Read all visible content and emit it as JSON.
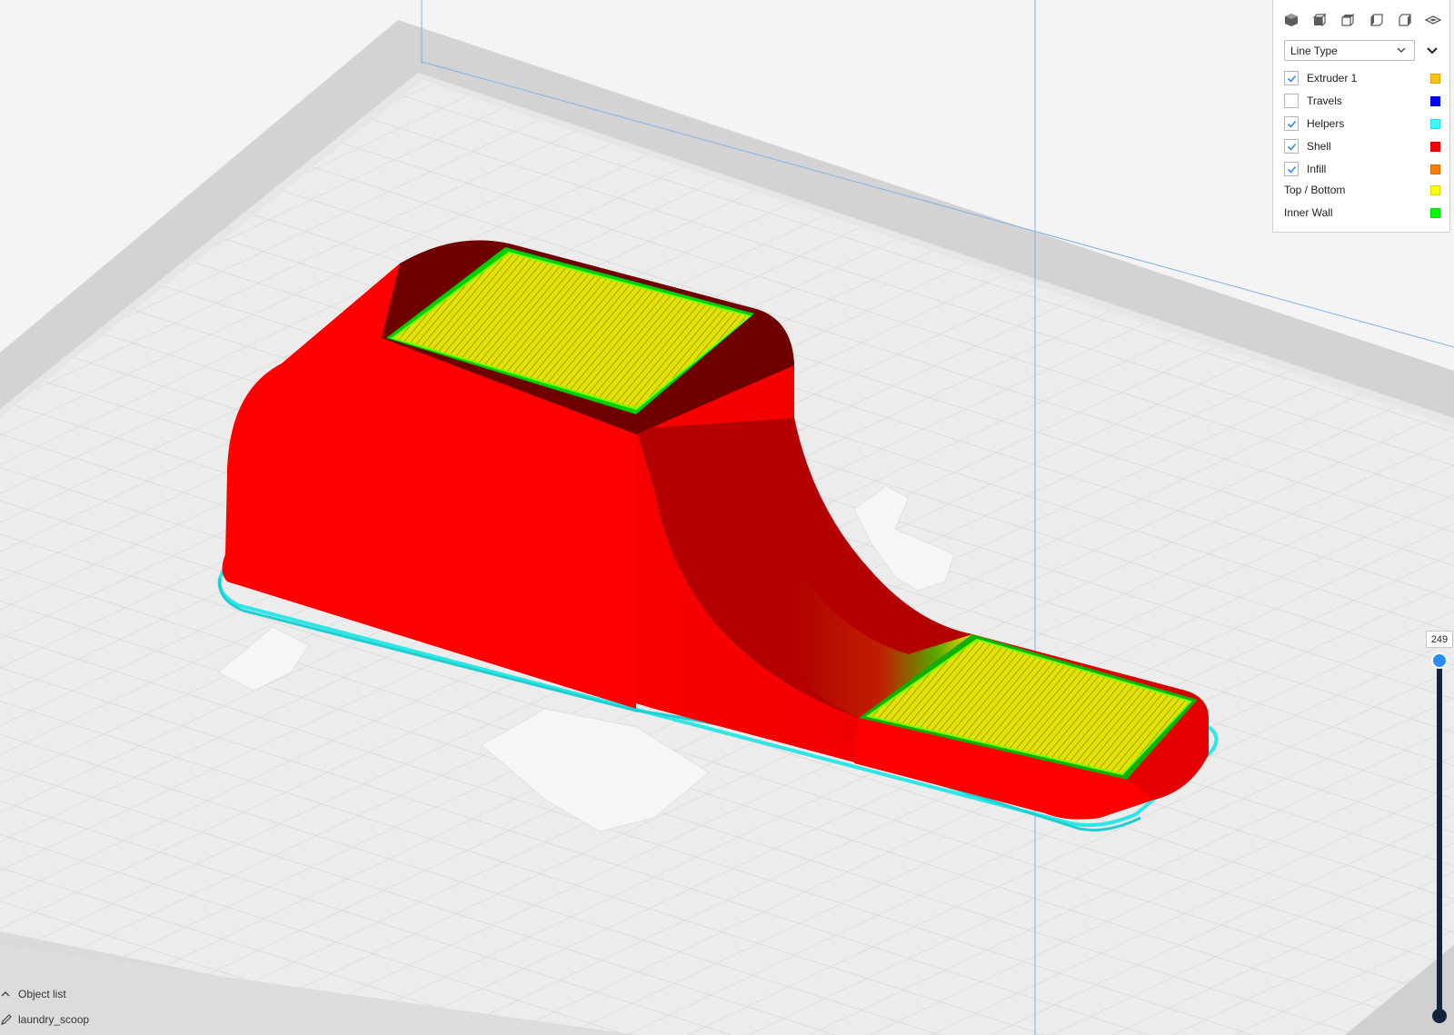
{
  "view_panel": {
    "camera_buttons": [
      {
        "name": "3d-view-icon"
      },
      {
        "name": "front-view-icon"
      },
      {
        "name": "top-view-icon"
      },
      {
        "name": "left-view-icon"
      },
      {
        "name": "right-view-icon"
      },
      {
        "name": "xray-view-icon"
      }
    ],
    "color_scheme": "Line Type",
    "legend": [
      {
        "label": "Extruder 1",
        "has_checkbox": true,
        "checked": true,
        "color": "#ffc20e"
      },
      {
        "label": "Travels",
        "has_checkbox": true,
        "checked": false,
        "color": "#0000ff"
      },
      {
        "label": "Helpers",
        "has_checkbox": true,
        "checked": true,
        "color": "#33ffff"
      },
      {
        "label": "Shell",
        "has_checkbox": true,
        "checked": true,
        "color": "#ff0000"
      },
      {
        "label": "Infill",
        "has_checkbox": true,
        "checked": true,
        "color": "#ff7f00"
      },
      {
        "label": "Top / Bottom",
        "has_checkbox": false,
        "color": "#ffff00"
      },
      {
        "label": "Inner Wall",
        "has_checkbox": false,
        "color": "#00ff00"
      }
    ]
  },
  "layer_slider": {
    "current_layer": "249"
  },
  "object_list": {
    "header": "Object list",
    "items": [
      "laundry_scoop"
    ]
  },
  "colors": {
    "accent": "#2b8cf0",
    "shell": "#ff0000",
    "top_bottom": "#ffff00",
    "inner_wall": "#00ff00",
    "helpers": "#33ffff"
  }
}
